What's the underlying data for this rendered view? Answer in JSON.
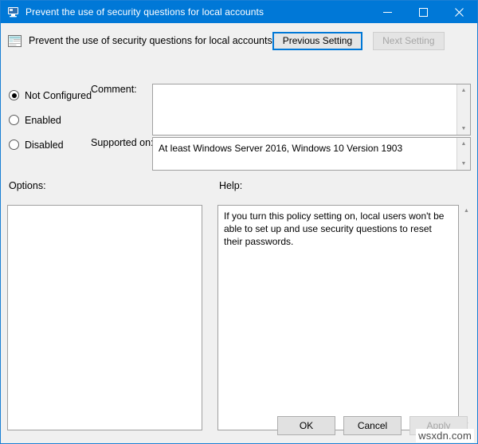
{
  "window": {
    "title": "Prevent the use of security questions for local accounts",
    "title_icon": "policy-monitor-icon",
    "controls": {
      "minimize": "─",
      "maximize": "☐",
      "close": "✕"
    }
  },
  "header": {
    "icon": "group-policy-setting-icon",
    "policy_title": "Prevent the use of security questions for local accounts",
    "previous_setting_label": "Previous Setting",
    "next_setting_label": "Next Setting",
    "next_setting_enabled": false,
    "previous_setting_focused": true
  },
  "state_options": {
    "selected": "Not Configured",
    "items": [
      {
        "label": "Not Configured",
        "selected": true
      },
      {
        "label": "Enabled",
        "selected": false
      },
      {
        "label": "Disabled",
        "selected": false
      }
    ]
  },
  "fields": {
    "comment_label": "Comment:",
    "comment_value": "",
    "comment_placeholder": "",
    "supported_on_label": "Supported on:",
    "supported_on_value": "At least Windows Server 2016, Windows 10 Version 1903"
  },
  "panels": {
    "options_label": "Options:",
    "options_content": "",
    "help_label": "Help:",
    "help_content": "If you turn this policy setting on, local users won't be able to set up and use security questions to reset their passwords."
  },
  "scrollbars": {
    "up_arrow": "▲",
    "down_arrow": "▼"
  },
  "footer": {
    "ok_label": "OK",
    "cancel_label": "Cancel",
    "apply_label": "Apply",
    "apply_enabled": false
  },
  "watermark": {
    "text": "wsxdn.com"
  },
  "colors": {
    "title_bar": "#0078d7",
    "accent_focus": "#0078d7",
    "dialog_background": "#f0f0f0",
    "field_background": "#ffffff",
    "disabled_text": "#a6a6a6"
  }
}
